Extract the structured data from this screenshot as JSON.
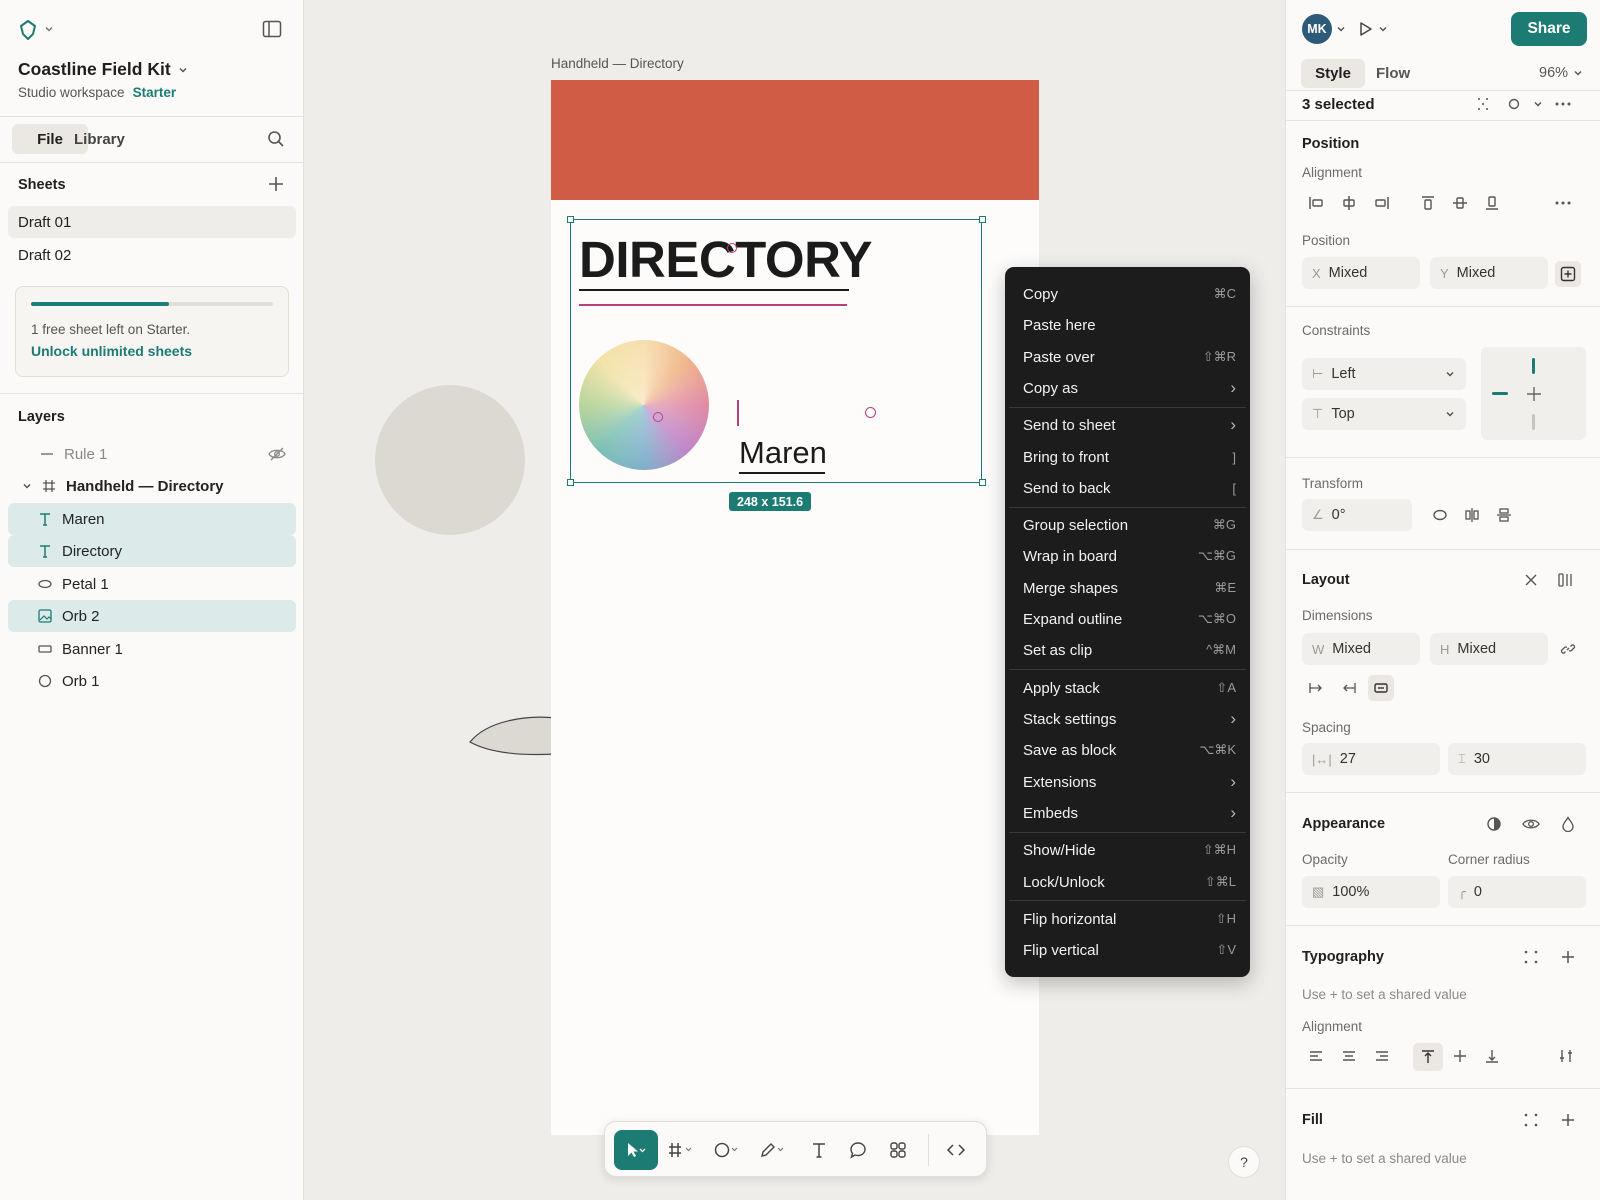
{
  "app": {
    "project_name": "Coastline Field Kit",
    "workspace": "Studio workspace",
    "plan": "Starter"
  },
  "left": {
    "tabs": [
      "File",
      "Library"
    ],
    "sheets_title": "Sheets",
    "sheets": [
      "Draft 01",
      "Draft 02"
    ],
    "upsell_text": "1 free sheet left on Starter.",
    "upsell_link": "Unlock unlimited sheets",
    "upsell_progress": 0.57,
    "layers_title": "Layers",
    "layers": [
      {
        "name": "Rule 1",
        "icon": "line-icon",
        "selected": false,
        "hidden": true
      },
      {
        "name": "Handheld — Directory",
        "icon": "frame-icon",
        "selected": false,
        "board": true
      },
      {
        "name": "Maren",
        "icon": "text-icon",
        "selected": true
      },
      {
        "name": "Directory",
        "icon": "text-icon",
        "selected": true
      },
      {
        "name": "Petal 1",
        "icon": "ellipse-icon",
        "selected": false
      },
      {
        "name": "Orb 2",
        "icon": "image-icon",
        "selected": true
      },
      {
        "name": "Banner 1",
        "icon": "rectangle-icon",
        "selected": false
      },
      {
        "name": "Orb 1",
        "icon": "circle-icon",
        "selected": false
      }
    ]
  },
  "canvas": {
    "board_label": "Handheld — Directory",
    "heading": "DIRECTORY",
    "name_text": "Maren",
    "size_badge": "248 x 151.6",
    "banner_color": "#d05c46"
  },
  "context_menu": {
    "items": [
      {
        "label": "Copy",
        "shortcut": "⌘C"
      },
      {
        "label": "Paste here",
        "shortcut": ""
      },
      {
        "label": "Paste over",
        "shortcut": "⇧⌘R"
      },
      {
        "label": "Copy as",
        "shortcut": "›"
      },
      {
        "label": "Send to sheet",
        "shortcut": "›"
      },
      {
        "label": "Bring to front",
        "shortcut": "]"
      },
      {
        "label": "Send to back",
        "shortcut": "["
      },
      {
        "label": "Group selection",
        "shortcut": "⌘G"
      },
      {
        "label": "Wrap in board",
        "shortcut": "⌥⌘G"
      },
      {
        "label": "Merge shapes",
        "shortcut": "⌘E"
      },
      {
        "label": "Expand outline",
        "shortcut": "⌥⌘O"
      },
      {
        "label": "Set as clip",
        "shortcut": "^⌘M"
      },
      {
        "label": "Apply stack",
        "shortcut": "⇧A"
      },
      {
        "label": "Stack settings",
        "shortcut": "›"
      },
      {
        "label": "Save as block",
        "shortcut": "⌥⌘K"
      },
      {
        "label": "Extensions",
        "shortcut": "›"
      },
      {
        "label": "Embeds",
        "shortcut": "›"
      },
      {
        "label": "Show/Hide",
        "shortcut": "⇧⌘H"
      },
      {
        "label": "Lock/Unlock",
        "shortcut": "⇧⌘L"
      },
      {
        "label": "Flip horizontal",
        "shortcut": "⇧H"
      },
      {
        "label": "Flip vertical",
        "shortcut": "⇧V"
      }
    ]
  },
  "right": {
    "avatar": "MK",
    "share": "Share",
    "tabs": [
      "Style",
      "Flow"
    ],
    "zoom": "96%",
    "selection": "3 selected",
    "position_title": "Position",
    "alignment_label": "Alignment",
    "position_label": "Position",
    "x_prefix": "X",
    "x_value": "Mixed",
    "y_prefix": "Y",
    "y_value": "Mixed",
    "constraints_label": "Constraints",
    "constraint_h": "Left",
    "constraint_v": "Top",
    "transform_label": "Transform",
    "rotation": "0°",
    "layout_title": "Layout",
    "dimensions_label": "Dimensions",
    "w_prefix": "W",
    "w_value": "Mixed",
    "h_prefix": "H",
    "h_value": "Mixed",
    "spacing_label": "Spacing",
    "spacing_h": "27",
    "spacing_v": "30",
    "appearance_title": "Appearance",
    "opacity_label": "Opacity",
    "opacity": "100%",
    "radius_label": "Corner radius",
    "radius": "0",
    "typography_title": "Typography",
    "typography_hint": "Use + to set a shared value",
    "typo_alignment_label": "Alignment",
    "fill_title": "Fill",
    "fill_hint": "Use + to set a shared value"
  },
  "colors": {
    "accent": "#1c7c74",
    "banner": "#d05c46",
    "highlight": "#b5427a"
  }
}
